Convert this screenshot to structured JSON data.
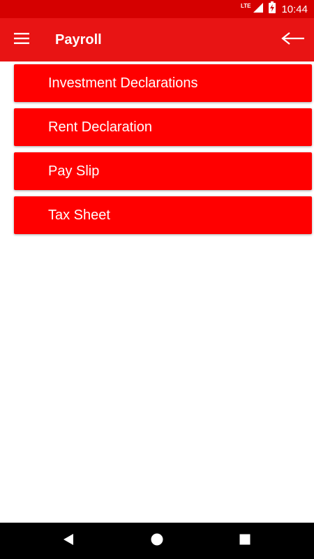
{
  "status_bar": {
    "network": "LTE",
    "time": "10:44",
    "icons": [
      "signal-icon",
      "battery-charging-icon"
    ]
  },
  "app_bar": {
    "title": "Payroll",
    "menu_icon": "hamburger-menu-icon",
    "back_icon": "back-arrow-icon"
  },
  "menu": {
    "items": [
      {
        "label": "Investment Declarations"
      },
      {
        "label": "Rent Declaration"
      },
      {
        "label": "Pay Slip"
      },
      {
        "label": "Tax Sheet"
      }
    ]
  },
  "nav_bar": {
    "icons": [
      "back-triangle-icon",
      "home-circle-icon",
      "recents-square-icon"
    ]
  },
  "colors": {
    "status_bar": "#d50000",
    "app_bar": "#e81414",
    "menu_item": "#ff0000",
    "text_on_red": "#ffffff",
    "nav_bar": "#000000"
  }
}
